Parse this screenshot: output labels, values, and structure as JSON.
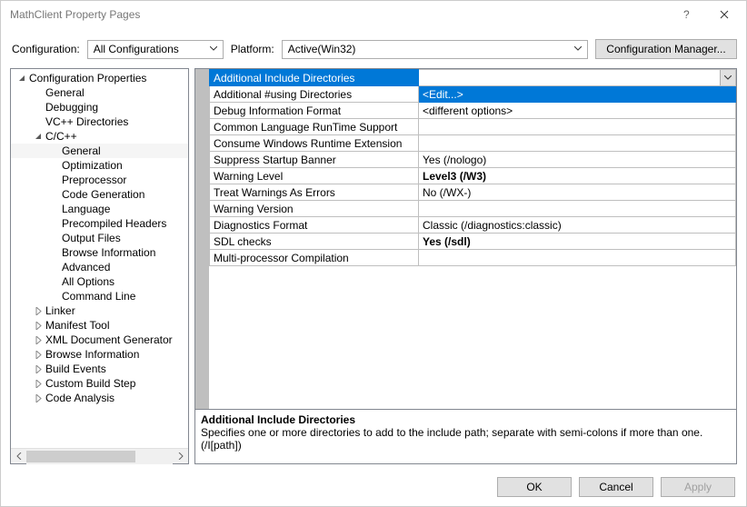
{
  "window": {
    "title": "MathClient Property Pages"
  },
  "toolbar": {
    "config_label": "Configuration:",
    "config_value": "All Configurations",
    "platform_label": "Platform:",
    "platform_value": "Active(Win32)",
    "config_mgr_label": "Configuration Manager..."
  },
  "tree": {
    "root": "Configuration Properties",
    "items": [
      {
        "label": "General",
        "type": "leaf",
        "depth": 1
      },
      {
        "label": "Debugging",
        "type": "leaf",
        "depth": 1
      },
      {
        "label": "VC++ Directories",
        "type": "leaf",
        "depth": 1
      },
      {
        "label": "C/C++",
        "type": "expanded",
        "depth": 1
      },
      {
        "label": "General",
        "type": "leaf",
        "depth": 2,
        "selected": true
      },
      {
        "label": "Optimization",
        "type": "leaf",
        "depth": 2
      },
      {
        "label": "Preprocessor",
        "type": "leaf",
        "depth": 2
      },
      {
        "label": "Code Generation",
        "type": "leaf",
        "depth": 2
      },
      {
        "label": "Language",
        "type": "leaf",
        "depth": 2
      },
      {
        "label": "Precompiled Headers",
        "type": "leaf",
        "depth": 2
      },
      {
        "label": "Output Files",
        "type": "leaf",
        "depth": 2
      },
      {
        "label": "Browse Information",
        "type": "leaf",
        "depth": 2
      },
      {
        "label": "Advanced",
        "type": "leaf",
        "depth": 2
      },
      {
        "label": "All Options",
        "type": "leaf",
        "depth": 2
      },
      {
        "label": "Command Line",
        "type": "leaf",
        "depth": 2
      },
      {
        "label": "Linker",
        "type": "collapsed",
        "depth": 1
      },
      {
        "label": "Manifest Tool",
        "type": "collapsed",
        "depth": 1
      },
      {
        "label": "XML Document Generator",
        "type": "collapsed",
        "depth": 1
      },
      {
        "label": "Browse Information",
        "type": "collapsed",
        "depth": 1
      },
      {
        "label": "Build Events",
        "type": "collapsed",
        "depth": 1
      },
      {
        "label": "Custom Build Step",
        "type": "collapsed",
        "depth": 1
      },
      {
        "label": "Code Analysis",
        "type": "collapsed",
        "depth": 1
      }
    ]
  },
  "grid": {
    "rows": [
      {
        "name": "Additional Include Directories",
        "value": "",
        "header": true
      },
      {
        "name": "Additional #using Directories",
        "value": "<Edit...>",
        "selected": true
      },
      {
        "name": "Debug Information Format",
        "value": "<different options>"
      },
      {
        "name": "Common Language RunTime Support",
        "value": ""
      },
      {
        "name": "Consume Windows Runtime Extension",
        "value": ""
      },
      {
        "name": "Suppress Startup Banner",
        "value": "Yes (/nologo)"
      },
      {
        "name": "Warning Level",
        "value": "Level3 (/W3)",
        "bold": true
      },
      {
        "name": "Treat Warnings As Errors",
        "value": "No (/WX-)"
      },
      {
        "name": "Warning Version",
        "value": ""
      },
      {
        "name": "Diagnostics Format",
        "value": "Classic (/diagnostics:classic)"
      },
      {
        "name": "SDL checks",
        "value": "Yes (/sdl)",
        "bold": true
      },
      {
        "name": "Multi-processor Compilation",
        "value": ""
      }
    ]
  },
  "description": {
    "title": "Additional Include Directories",
    "body": "Specifies one or more directories to add to the include path; separate with semi-colons if more than one. (/I[path])"
  },
  "footer": {
    "ok": "OK",
    "cancel": "Cancel",
    "apply": "Apply"
  }
}
